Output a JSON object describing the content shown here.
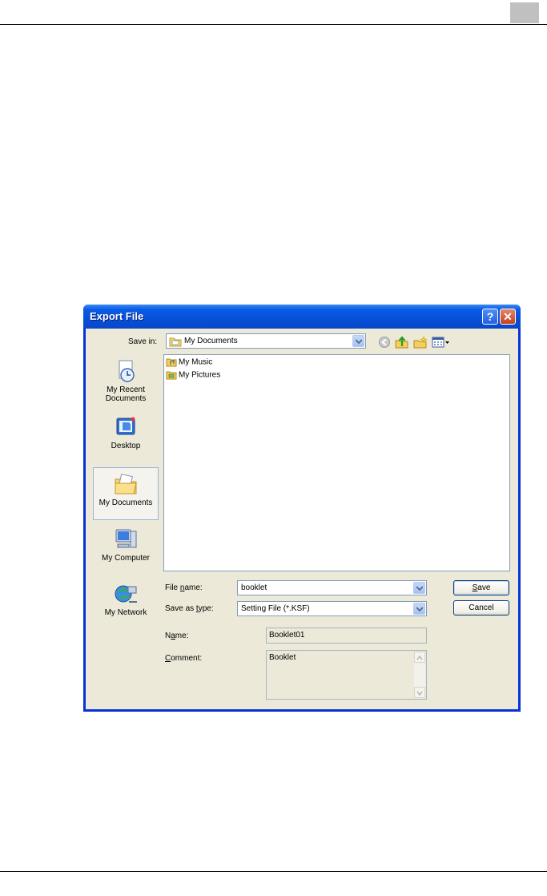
{
  "dialog": {
    "title": "Export File",
    "help_label": "?",
    "close_label": "✕"
  },
  "save_in": {
    "label": "Save in:",
    "value": "My Documents"
  },
  "toolbar": {
    "icons": [
      "back-icon",
      "up-folder-icon",
      "new-folder-icon",
      "views-menu-icon"
    ]
  },
  "places": [
    {
      "label_line1": "My Recent",
      "label_line2": "Documents",
      "icon": "recent-documents-icon"
    },
    {
      "label_line1": "Desktop",
      "icon": "desktop-icon"
    },
    {
      "label_line1": "My Documents",
      "icon": "my-documents-icon"
    },
    {
      "label_line1": "My Computer",
      "icon": "my-computer-icon"
    },
    {
      "label_line1": "My Network",
      "icon": "my-network-icon"
    }
  ],
  "files": [
    {
      "name": "My Music",
      "icon": "music-folder-icon"
    },
    {
      "name": "My Pictures",
      "icon": "pictures-folder-icon"
    }
  ],
  "file_name": {
    "label_pre": "File ",
    "label_u": "n",
    "label_post": "ame:",
    "value": "booklet"
  },
  "save_as_type": {
    "label_pre": "Save as ",
    "label_u": "t",
    "label_post": "ype:",
    "value": "Setting File (*.KSF)"
  },
  "buttons": {
    "save_u": "S",
    "save_rest": "ave",
    "cancel": "Cancel"
  },
  "name_field": {
    "label_pre": "N",
    "label_u": "a",
    "label_post": "me:",
    "value": "Booklet01"
  },
  "comment_field": {
    "label_u": "C",
    "label_post": "omment:",
    "value": "Booklet"
  },
  "colors": {
    "titlebar": "#0a5ce6",
    "client": "#ece9d8",
    "close": "#c6401f"
  }
}
